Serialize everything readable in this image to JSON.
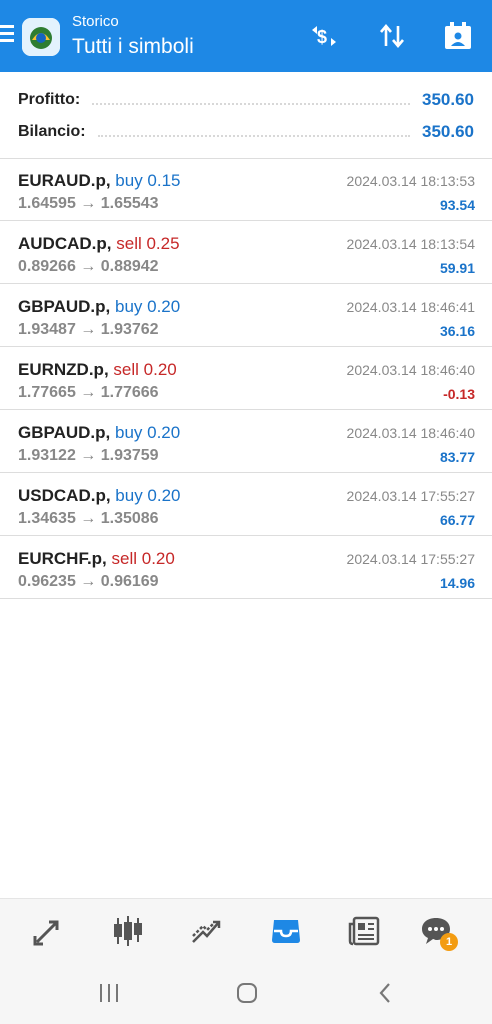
{
  "header": {
    "subtitle": "Storico",
    "title": "Tutti i simboli",
    "accent_color": "#1e88e5",
    "icons": [
      "menu-icon",
      "app-logo-icon",
      "currency-exchange-icon",
      "sort-icon",
      "calendar-icon"
    ]
  },
  "summary": {
    "profit_label": "Profitto:",
    "profit_value": "350.60",
    "balance_label": "Bilancio:",
    "balance_value": "350.60"
  },
  "deals": [
    {
      "symbol": "EURAUD.p,",
      "side": "buy 0.15",
      "prices": "1.64595 → 1.65543",
      "time": "2024.03.14 18:13:53",
      "profit": "93.54"
    },
    {
      "symbol": "AUDCAD.p,",
      "side": "sell 0.25",
      "prices": "0.89266 → 0.88942",
      "time": "2024.03.14 18:13:54",
      "profit": "59.91"
    },
    {
      "symbol": "GBPAUD.p,",
      "side": "buy 0.20",
      "prices": "1.93487 → 1.93762",
      "time": "2024.03.14 18:46:41",
      "profit": "36.16"
    },
    {
      "symbol": "EURNZD.p,",
      "side": "sell 0.20",
      "prices": "1.77665 → 1.77666",
      "time": "2024.03.14 18:46:40",
      "profit": "-0.13"
    },
    {
      "symbol": "GBPAUD.p,",
      "side": "buy 0.20",
      "prices": "1.93122 → 1.93759",
      "time": "2024.03.14 18:46:40",
      "profit": "83.77"
    },
    {
      "symbol": "USDCAD.p,",
      "side": "buy 0.20",
      "prices": "1.34635 → 1.35086",
      "time": "2024.03.14 17:55:27",
      "profit": "66.77"
    },
    {
      "symbol": "EURCHF.p,",
      "side": "sell 0.20",
      "prices": "0.96235 → 0.96169",
      "time": "2024.03.14 17:55:27",
      "profit": "14.96"
    }
  ],
  "colors": {
    "buy": "#1a73c9",
    "sell": "#c62828",
    "profit_positive": "#1a73c9",
    "profit_negative": "#c62828",
    "active_nav": "#1e88e5",
    "inactive_nav": "#555555"
  },
  "bottom_nav": {
    "items": [
      "quotes-icon",
      "charts-icon",
      "trade-icon",
      "history-icon",
      "news-icon",
      "chat-icon"
    ],
    "active": "history-icon",
    "chat_badge": "1"
  },
  "system_nav": [
    "recent-apps-icon",
    "home-icon",
    "back-icon"
  ]
}
